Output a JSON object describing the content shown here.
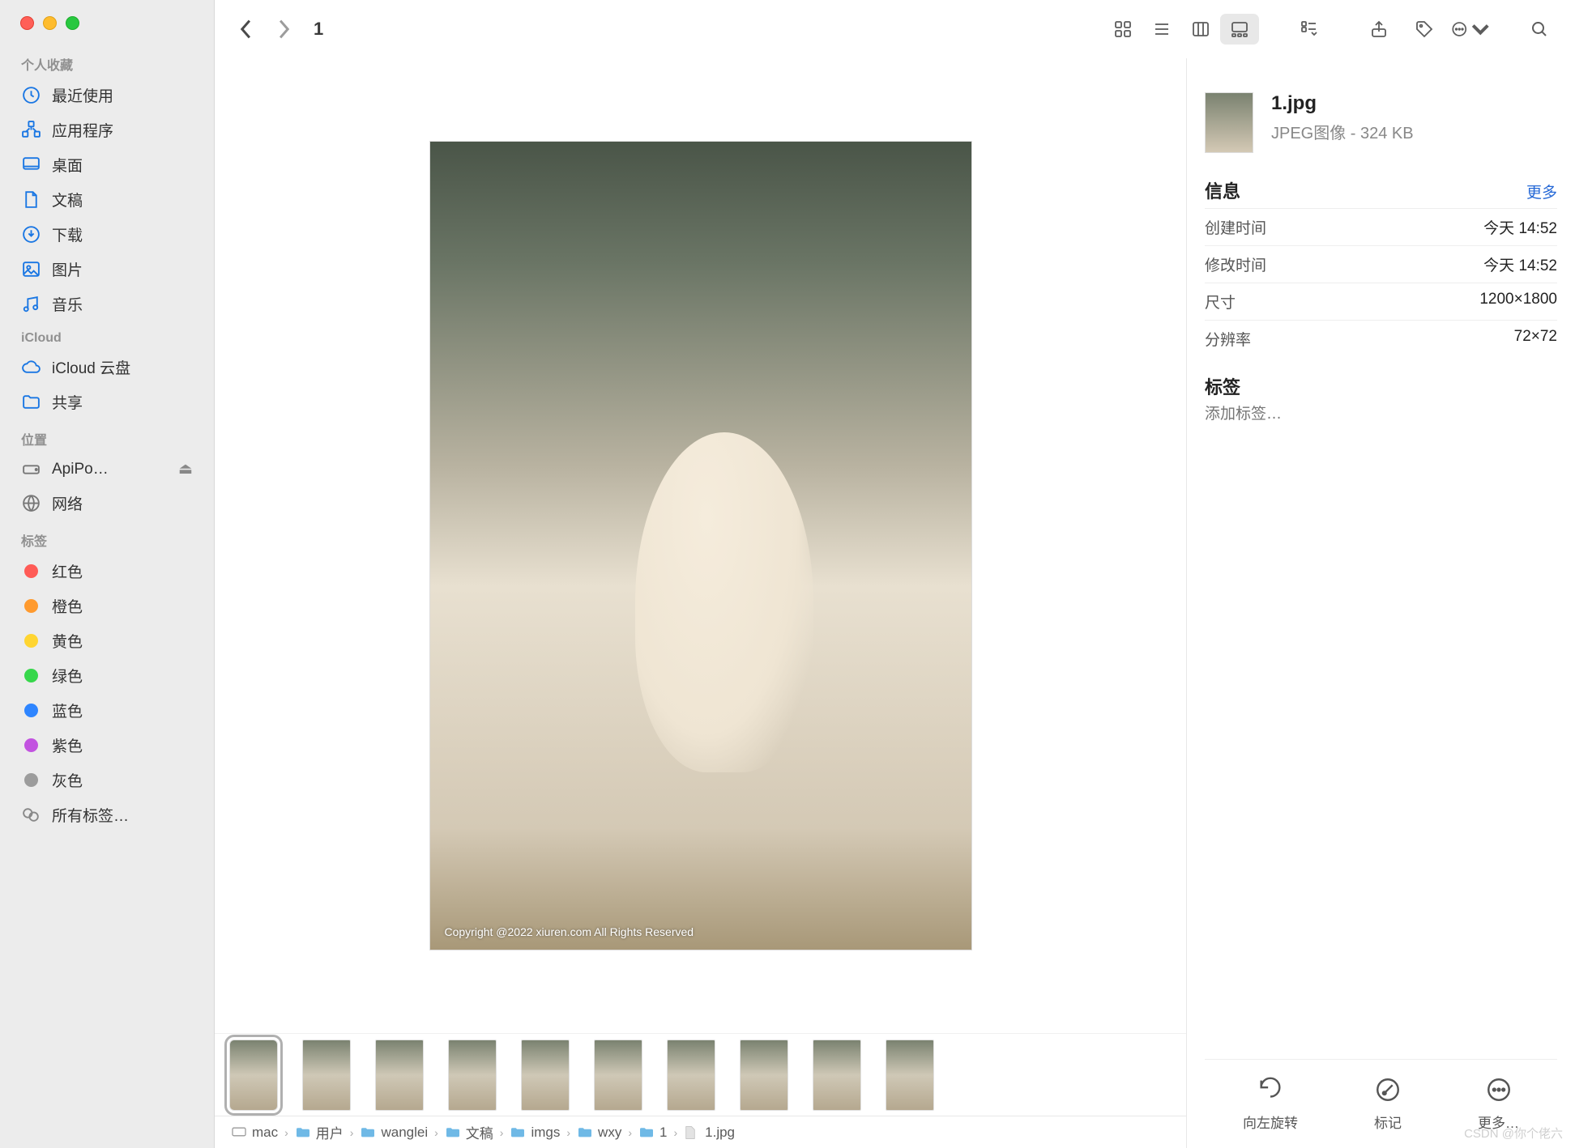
{
  "toolbar": {
    "title": "1"
  },
  "sidebar": {
    "groups": [
      {
        "label": "个人收藏",
        "items": [
          {
            "icon": "clock-icon",
            "label": "最近使用"
          },
          {
            "icon": "app-icon",
            "label": "应用程序"
          },
          {
            "icon": "desktop-icon",
            "label": "桌面"
          },
          {
            "icon": "document-icon",
            "label": "文稿"
          },
          {
            "icon": "download-icon",
            "label": "下载"
          },
          {
            "icon": "picture-icon",
            "label": "图片"
          },
          {
            "icon": "music-icon",
            "label": "音乐"
          }
        ]
      },
      {
        "label": "iCloud",
        "items": [
          {
            "icon": "cloud-icon",
            "label": "iCloud 云盘"
          },
          {
            "icon": "share-folder-icon",
            "label": "共享"
          }
        ]
      },
      {
        "label": "位置",
        "items": [
          {
            "icon": "drive-icon",
            "label": "ApiPo…",
            "eject": true
          },
          {
            "icon": "network-icon",
            "label": "网络"
          }
        ]
      },
      {
        "label": "标签",
        "items": [
          {
            "color": "#ff5b56",
            "label": "红色"
          },
          {
            "color": "#ff9a2e",
            "label": "橙色"
          },
          {
            "color": "#ffd531",
            "label": "黄色"
          },
          {
            "color": "#37d74b",
            "label": "绿色"
          },
          {
            "color": "#2e85ff",
            "label": "蓝色"
          },
          {
            "color": "#c253e0",
            "label": "紫色"
          },
          {
            "color": "#9c9c9c",
            "label": "灰色"
          },
          {
            "icon": "alltags-icon",
            "label": "所有标签…"
          }
        ]
      }
    ]
  },
  "preview": {
    "copyright": "Copyright @2022  xiuren.com  All Rights Reserved",
    "thumbnails_count": 10,
    "selected_index": 0
  },
  "pathbar": [
    {
      "icon": "disk",
      "label": "mac"
    },
    {
      "icon": "folder",
      "label": "用户"
    },
    {
      "icon": "folder",
      "label": "wanglei"
    },
    {
      "icon": "folder",
      "label": "文稿"
    },
    {
      "icon": "folder",
      "label": "imgs"
    },
    {
      "icon": "folder",
      "label": "wxy"
    },
    {
      "icon": "folder",
      "label": "1"
    },
    {
      "icon": "file",
      "label": "1.jpg"
    }
  ],
  "inspector": {
    "file_name": "1.jpg",
    "file_meta": "JPEG图像 - 324 KB",
    "info_title": "信息",
    "more_label": "更多",
    "rows": [
      {
        "key": "创建时间",
        "val": "今天 14:52"
      },
      {
        "key": "修改时间",
        "val": "今天 14:52"
      },
      {
        "key": "尺寸",
        "val": "1200×1800"
      },
      {
        "key": "分辨率",
        "val": "72×72"
      }
    ],
    "tags_title": "标签",
    "tags_placeholder": "添加标签…",
    "actions": [
      {
        "icon": "rotate-left-icon",
        "label": "向左旋转"
      },
      {
        "icon": "markup-icon",
        "label": "标记"
      },
      {
        "icon": "more-icon",
        "label": "更多…"
      }
    ]
  },
  "watermark": "CSDN @你个佬六"
}
